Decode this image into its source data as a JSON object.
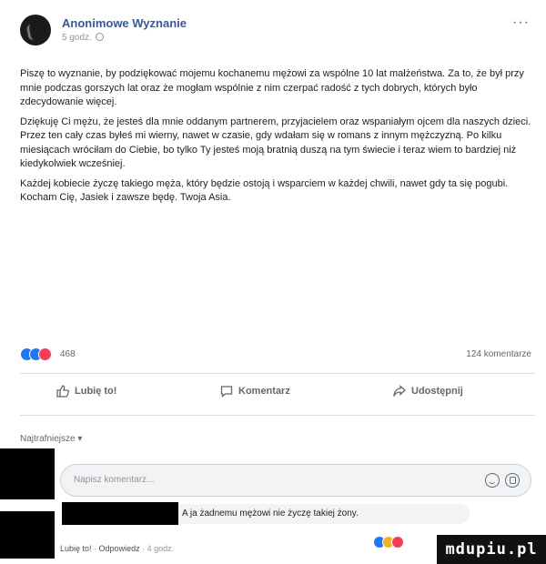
{
  "post": {
    "author": "Anonimowe Wyznanie",
    "time": "5 godz.",
    "paragraphs": [
      "Piszę to wyznanie, by podziękować mojemu kochanemu mężowi za wspólne 10 lat małżeństwa. Za to, że był przy mnie podczas gorszych lat oraz że mogłam wspólnie z nim czerpać radość z tych dobrych, których było zdecydowanie więcej.",
      "Dziękuję Ci mężu, że jesteś dla mnie oddanym partnerem, przyjacielem oraz wspaniałym ojcem dla naszych dzieci. Przez ten cały czas byłeś mi wierny, nawet w czasie, gdy wdałam się w romans z innym mężczyzną. Po kilku miesiącach wróciłam do Ciebie, bo tylko Ty jesteś moją bratnią duszą na tym świecie i teraz wiem to bardziej niż kiedykolwiek wcześniej.",
      "Każdej kobiecie życzę takiego męża, który będzie ostoją i wsparciem w każdej chwili, nawet gdy ta się pogubi. Kocham Cię, Jasiek i zawsze będę. Twoja Asia."
    ],
    "reaction_count": "468",
    "comment_count": "124 komentarze",
    "colors": {
      "link": "#385898",
      "like": "#2078f4",
      "love": "#f33e58",
      "haha": "#f7b125"
    }
  },
  "actions": {
    "like": "Lubię to!",
    "comment": "Komentarz",
    "share": "Udostępnij"
  },
  "comments": {
    "sort_label": "Najtrafniejsze ▾",
    "input_placeholder": "Napisz komentarz...",
    "reply_text": "A ja żadnemu mężowi nie życzę takiej żony.",
    "reply_like": "Lubię to!",
    "reply_answer": "Odpowiedz",
    "reply_time": "4 godz."
  },
  "watermark": "mdupiu.pl"
}
